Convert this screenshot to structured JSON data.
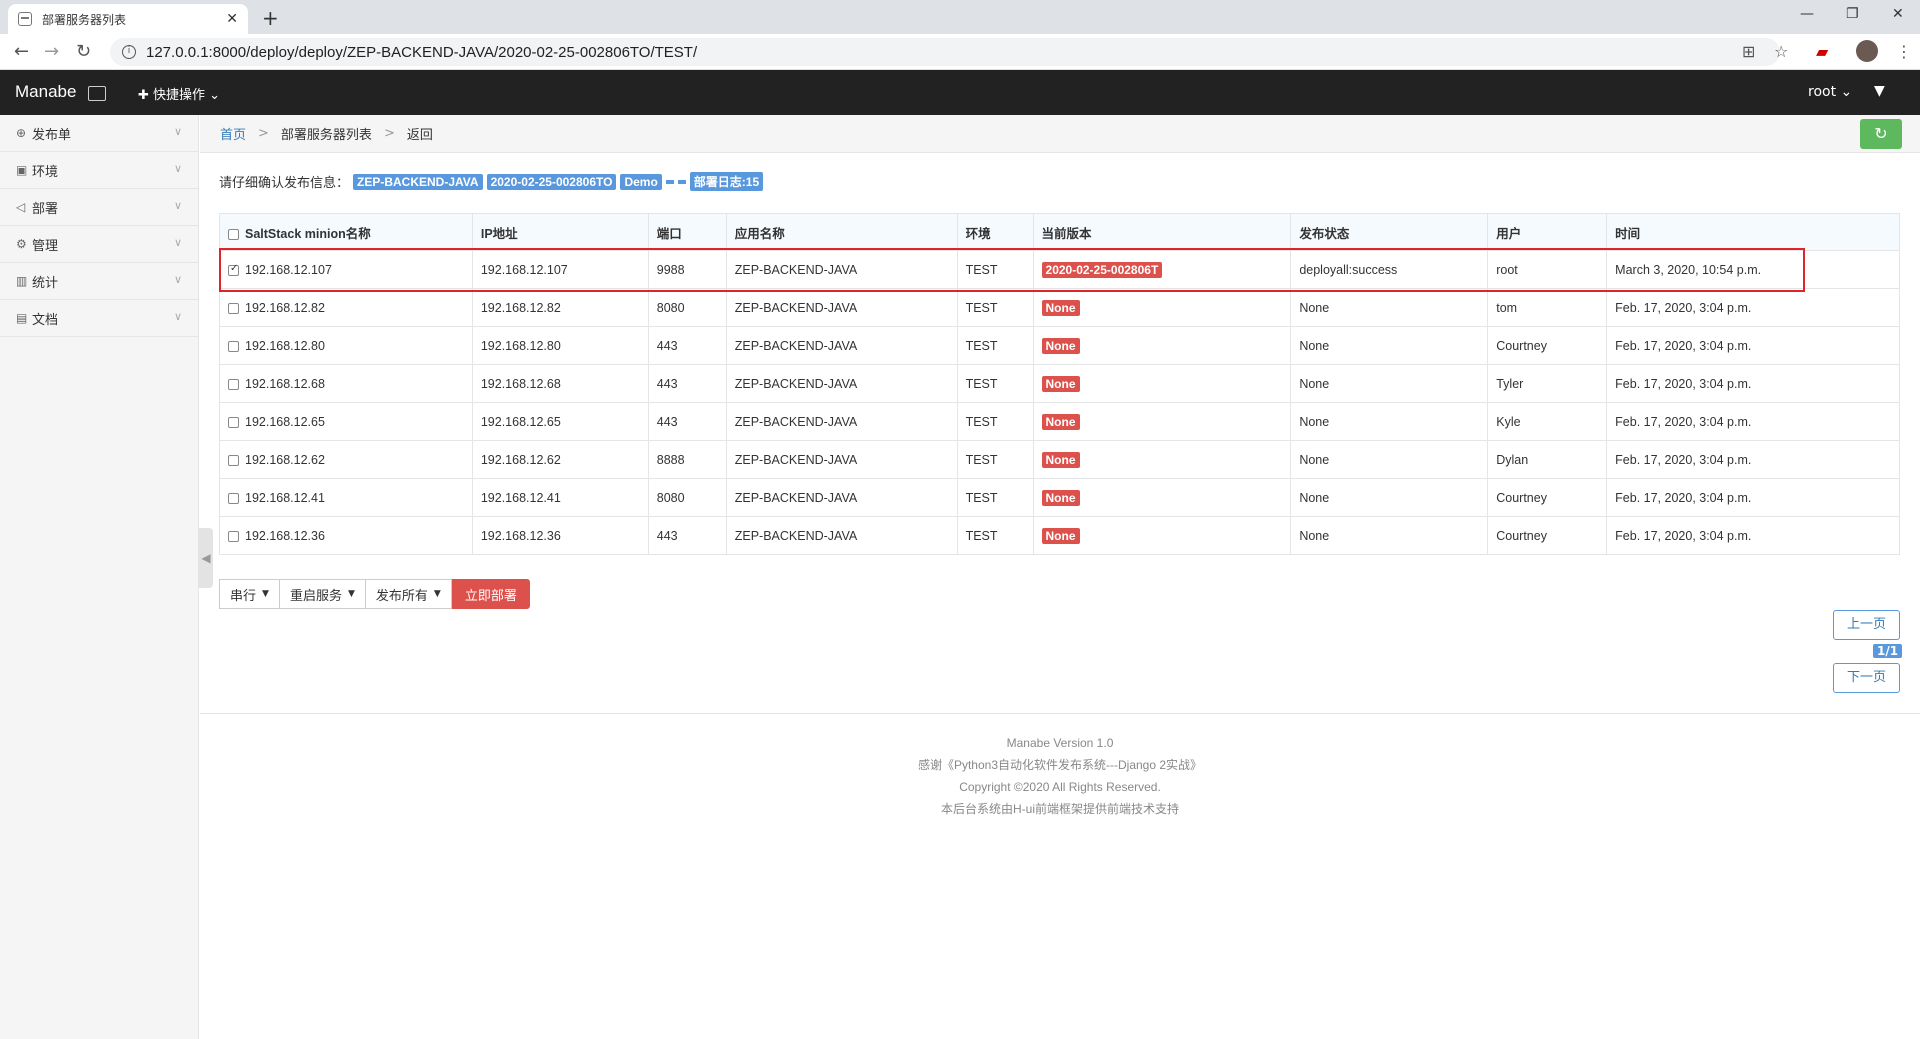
{
  "browser": {
    "tab_title": "部署服务器列表",
    "tab_close": "✕",
    "new_tab": "+",
    "url": "127.0.0.1:8000/deploy/deploy/ZEP-BACKEND-JAVA/2020-02-25-002806TO/TEST/"
  },
  "navbar": {
    "brand": "Manabe",
    "quick_action": "✚ 快捷操作 ⌄",
    "user": "root ⌄"
  },
  "sidebar": {
    "items": [
      {
        "icon": "⊕",
        "label": "发布单"
      },
      {
        "icon": "▣",
        "label": "环境"
      },
      {
        "icon": "◁",
        "label": "部署"
      },
      {
        "icon": "⚙",
        "label": "管理"
      },
      {
        "icon": "▥",
        "label": "统计"
      },
      {
        "icon": "▤",
        "label": "文档"
      }
    ]
  },
  "breadcrumb": {
    "home": "首页",
    "sep": ">",
    "current": "部署服务器列表",
    "back": "返回"
  },
  "confirm": {
    "text": "请仔细确认发布信息：",
    "app": "ZEP-BACKEND-JAVA",
    "version": "2020-02-25-002806TO",
    "env": "Demo",
    "log": "部署日志:15"
  },
  "table": {
    "headers": [
      "SaltStack minion名称",
      "IP地址",
      "端口",
      "应用名称",
      "环境",
      "当前版本",
      "发布状态",
      "用户",
      "时间"
    ],
    "rows": [
      {
        "checked": true,
        "minion": "192.168.12.107",
        "ip": "192.168.12.107",
        "port": "9988",
        "app": "ZEP-BACKEND-JAVA",
        "env": "TEST",
        "version": "2020-02-25-002806T",
        "status": "deployall:success",
        "user": "root",
        "time": "March 3, 2020, 10:54 p.m."
      },
      {
        "checked": false,
        "minion": "192.168.12.82",
        "ip": "192.168.12.82",
        "port": "8080",
        "app": "ZEP-BACKEND-JAVA",
        "env": "TEST",
        "version": "None",
        "status": "None",
        "user": "tom",
        "time": "Feb. 17, 2020, 3:04 p.m."
      },
      {
        "checked": false,
        "minion": "192.168.12.80",
        "ip": "192.168.12.80",
        "port": "443",
        "app": "ZEP-BACKEND-JAVA",
        "env": "TEST",
        "version": "None",
        "status": "None",
        "user": "Courtney",
        "time": "Feb. 17, 2020, 3:04 p.m."
      },
      {
        "checked": false,
        "minion": "192.168.12.68",
        "ip": "192.168.12.68",
        "port": "443",
        "app": "ZEP-BACKEND-JAVA",
        "env": "TEST",
        "version": "None",
        "status": "None",
        "user": "Tyler",
        "time": "Feb. 17, 2020, 3:04 p.m."
      },
      {
        "checked": false,
        "minion": "192.168.12.65",
        "ip": "192.168.12.65",
        "port": "443",
        "app": "ZEP-BACKEND-JAVA",
        "env": "TEST",
        "version": "None",
        "status": "None",
        "user": "Kyle",
        "time": "Feb. 17, 2020, 3:04 p.m."
      },
      {
        "checked": false,
        "minion": "192.168.12.62",
        "ip": "192.168.12.62",
        "port": "8888",
        "app": "ZEP-BACKEND-JAVA",
        "env": "TEST",
        "version": "None",
        "status": "None",
        "user": "Dylan",
        "time": "Feb. 17, 2020, 3:04 p.m."
      },
      {
        "checked": false,
        "minion": "192.168.12.41",
        "ip": "192.168.12.41",
        "port": "8080",
        "app": "ZEP-BACKEND-JAVA",
        "env": "TEST",
        "version": "None",
        "status": "None",
        "user": "Courtney",
        "time": "Feb. 17, 2020, 3:04 p.m."
      },
      {
        "checked": false,
        "minion": "192.168.12.36",
        "ip": "192.168.12.36",
        "port": "443",
        "app": "ZEP-BACKEND-JAVA",
        "env": "TEST",
        "version": "None",
        "status": "None",
        "user": "Courtney",
        "time": "Feb. 17, 2020, 3:04 p.m."
      }
    ]
  },
  "actions": {
    "serial": "串行",
    "restart": "重启服务",
    "deploy_all": "发布所有",
    "deploy_now": "立即部署"
  },
  "pager": {
    "prev": "上一页",
    "page": "1/1",
    "next": "下一页"
  },
  "footer": {
    "lines": [
      "Manabe Version 1.0",
      "感谢《Python3自动化软件发布系统---Django 2实战》",
      "Copyright ©2020 All Rights Reserved.",
      "本后台系统由H-ui前端框架提供前端技术支持"
    ]
  },
  "colors": {
    "navbar": "#222222",
    "primary": "#5a98de",
    "danger": "#dd514c",
    "success": "#5eb95e",
    "highlight": "#e0242b"
  }
}
